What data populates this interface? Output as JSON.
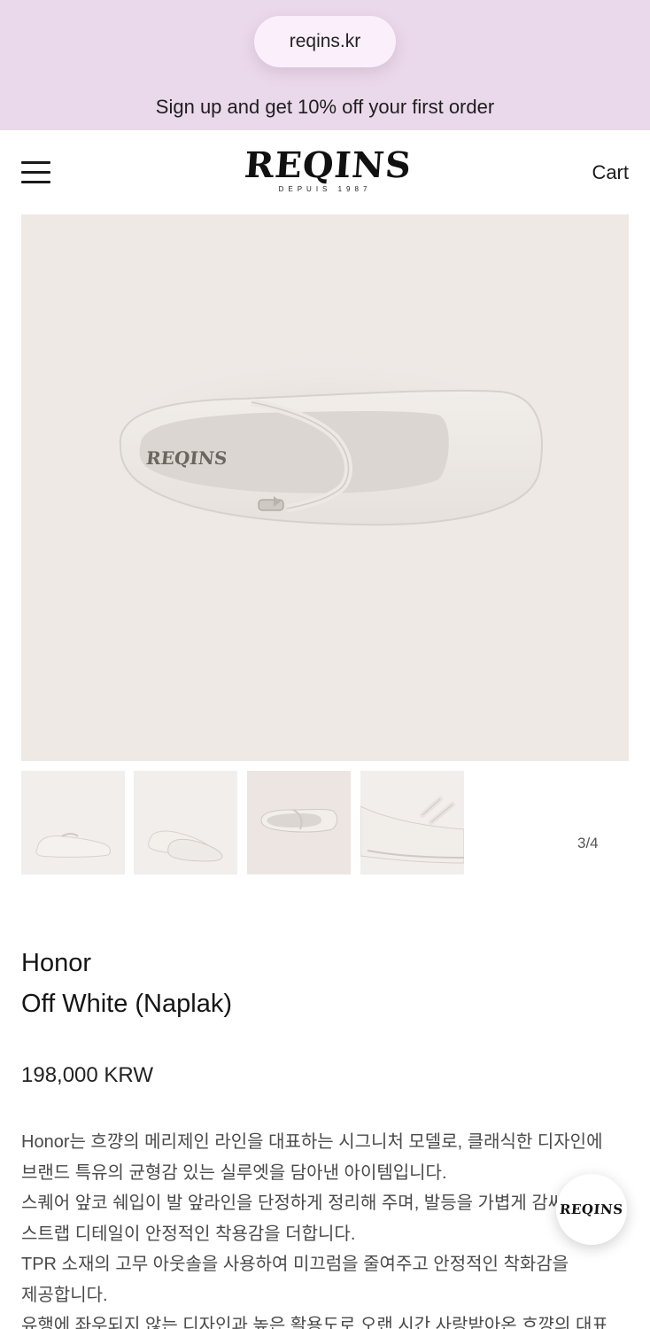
{
  "browser": {
    "url": "reqins.kr"
  },
  "promo_banner": {
    "text": "Sign up and get 10% off your first order"
  },
  "header": {
    "logo_text": "REQINS",
    "logo_subtext": "DEPUIS 1987",
    "cart_label": "Cart",
    "menu_icon": "hamburger-menu-icon"
  },
  "gallery": {
    "counter": "3/4",
    "thumbnails": [
      "product-view-1",
      "product-view-2",
      "product-view-3",
      "product-view-4"
    ],
    "active_index": 3,
    "image_logo_text": "REQINS"
  },
  "product": {
    "name_line1": "Honor",
    "name_line2": "Off White (Naplak)",
    "price": "198,000 KRW",
    "description": [
      "Honor는 흐꺙의 메리제인 라인을 대표하는 시그니처 모델로, 클래식한 디자인에",
      "브랜드 특유의 균형감 있는 실루엣을 담아낸 아이템입니다.",
      "스퀘어 앞코 쉐입이 발 앞라인을 단정하게 정리해 주며, 발등을 가볍게 감싸는",
      "스트랩 디테일이 안정적인 착용감을 더합니다.",
      "TPR 소재의 고무 아웃솔을 사용하여 미끄럼을 줄여주고 안정적인 착화감을",
      "제공합니다.",
      "유행에 좌우되지 않는 디자인과 높은 활용도로 오랜 시간 사랑받아온 흐꺙의 대표"
    ]
  },
  "floating_button": {
    "label": "REQINS"
  },
  "colors": {
    "banner_bg": "#ead9ea",
    "hero_bg": "#efe9e6"
  }
}
